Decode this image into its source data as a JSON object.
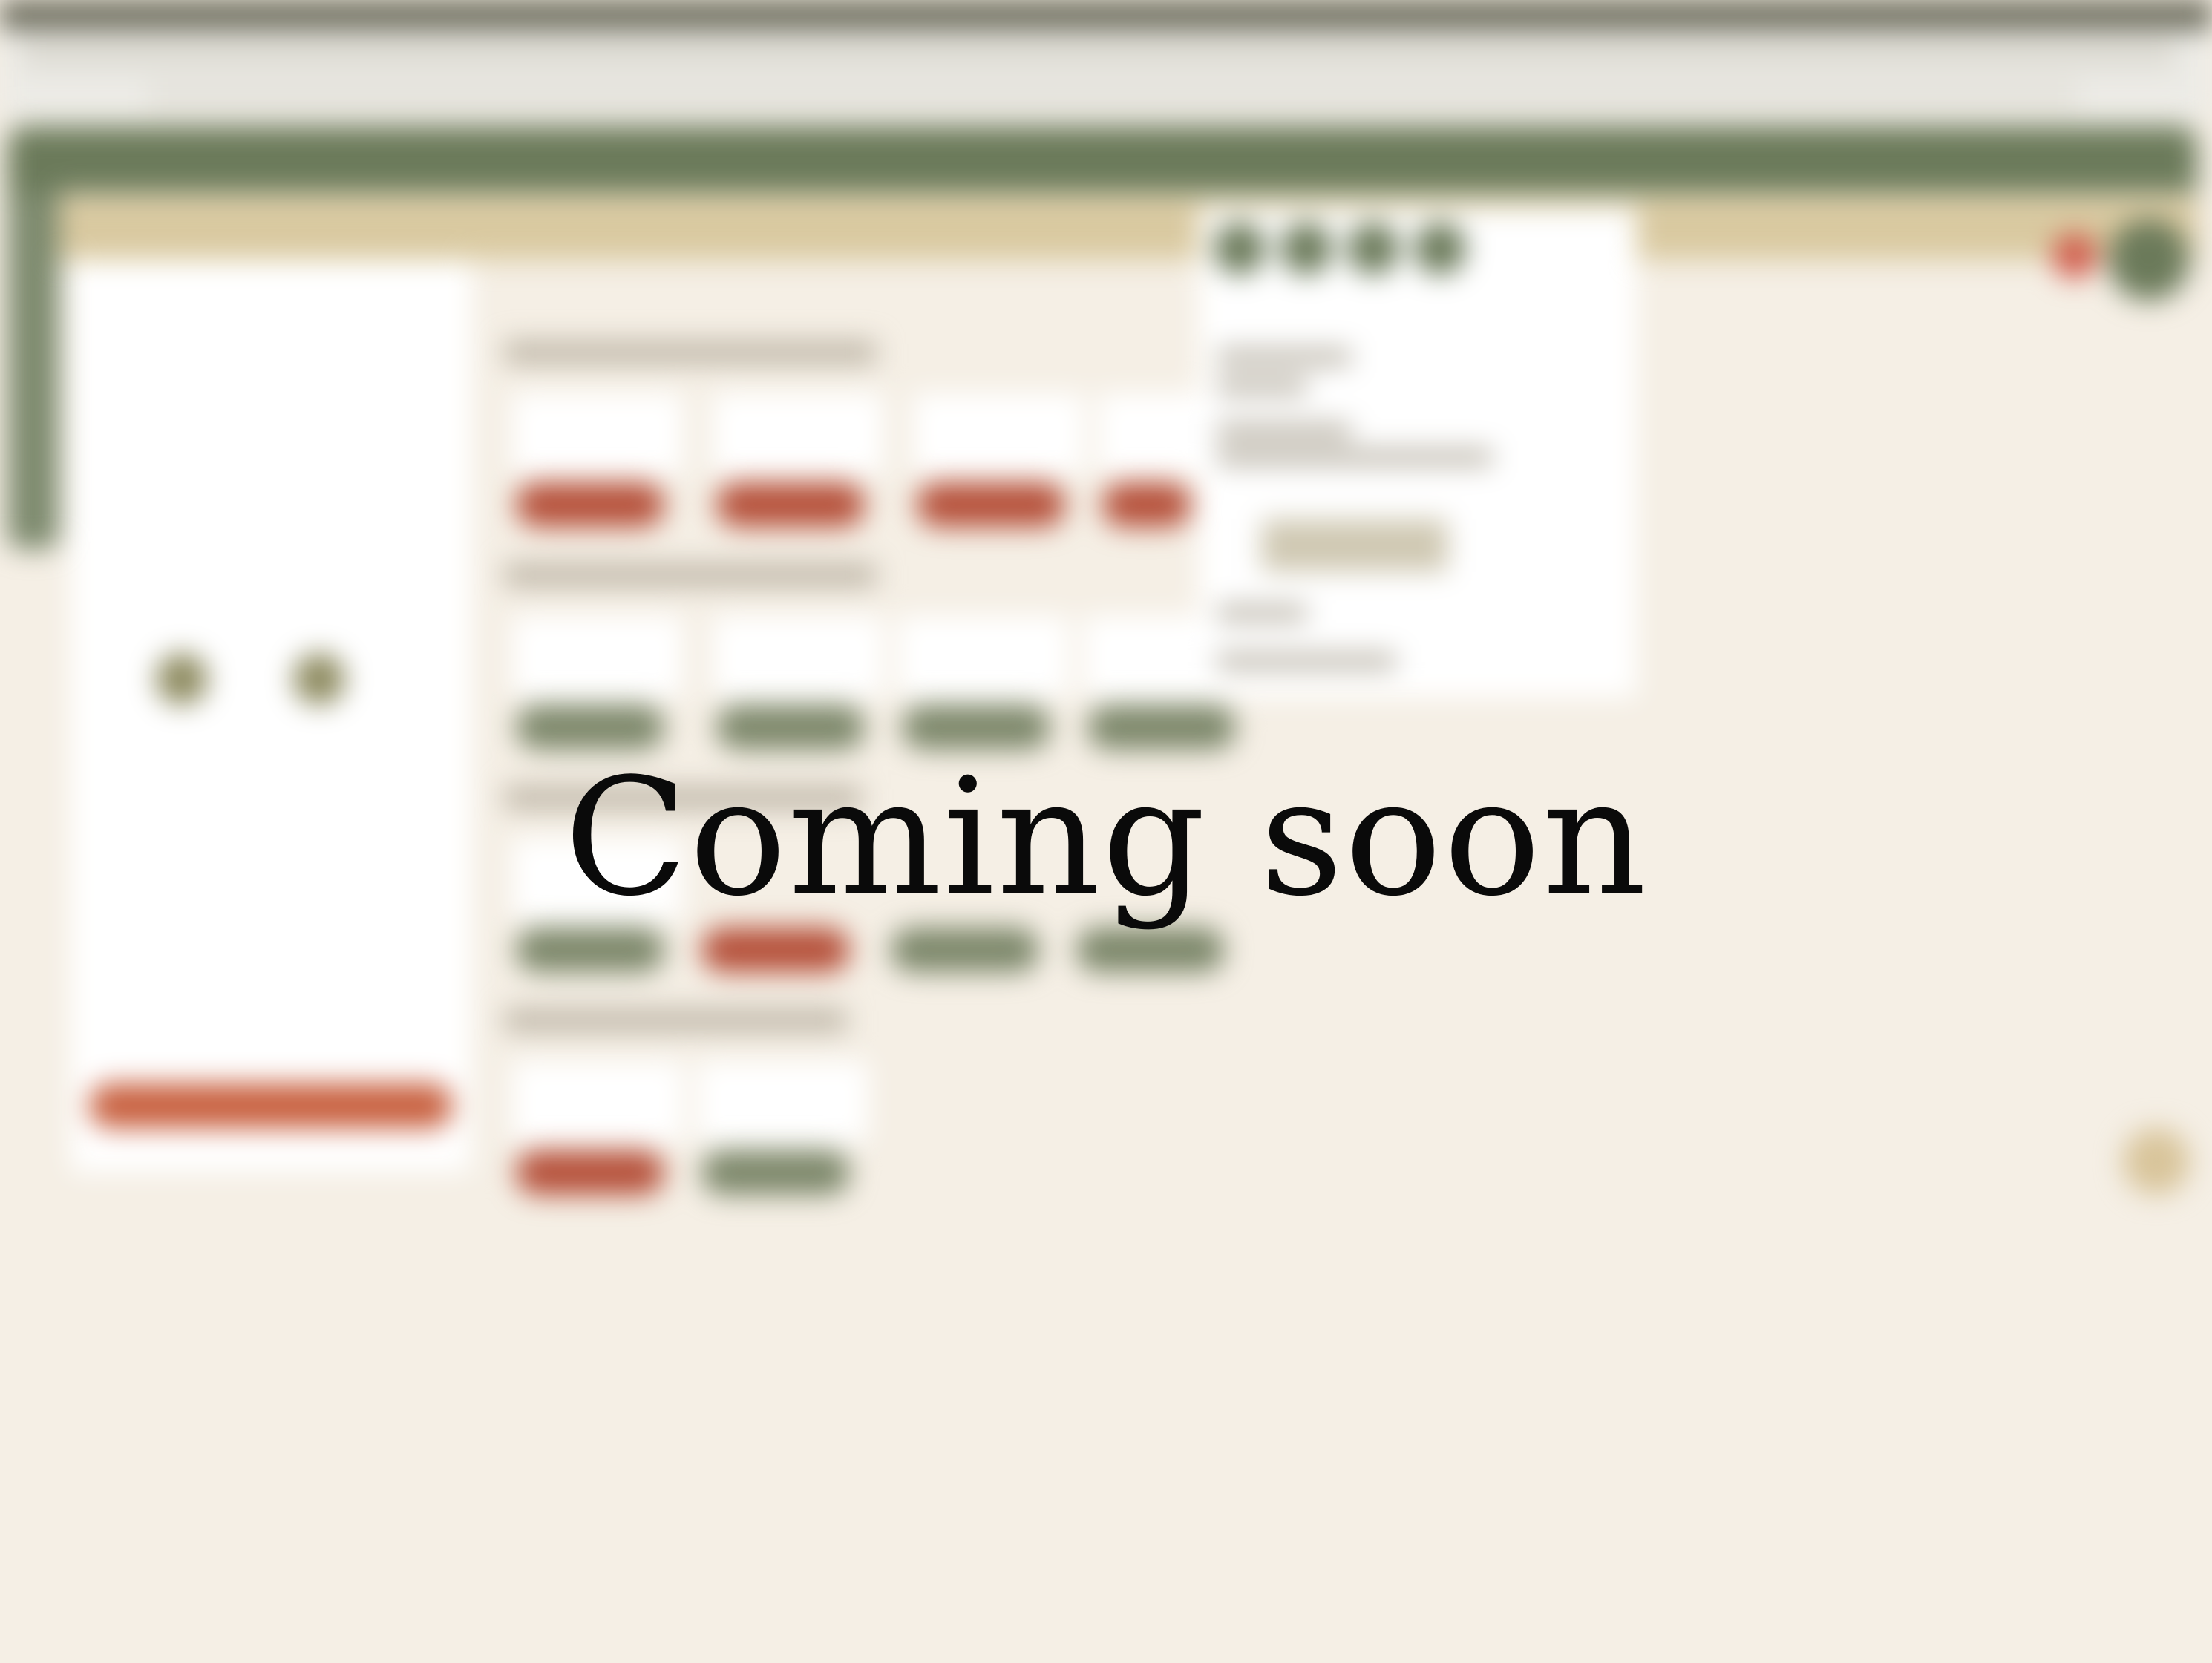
{
  "overlay": {
    "title": "Coming soon"
  },
  "colors": {
    "page_background": "#f5efe5",
    "header_green": "#6b7a5a",
    "subbar_tan": "#d9c9a0",
    "accent_red": "#b5503a",
    "accent_green": "#7c876a",
    "cta_orange": "#c8603f",
    "title_text": "#0a0a0a"
  }
}
